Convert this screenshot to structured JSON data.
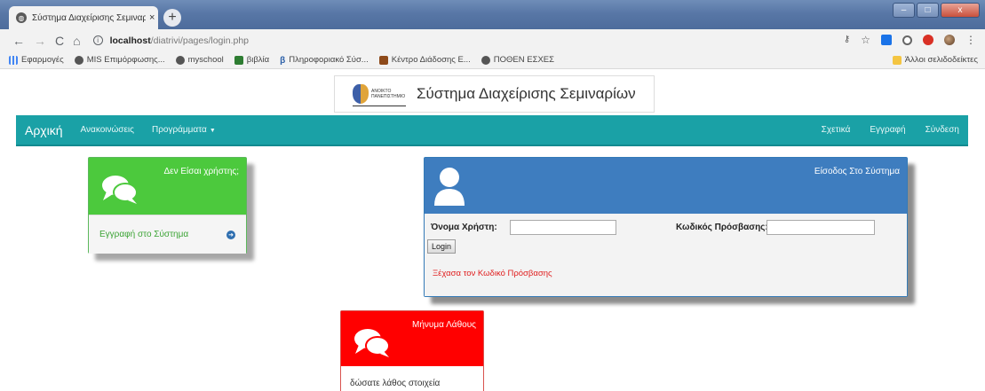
{
  "browser": {
    "tab_title": "Σύστημα Διαχείρισης Σεμιναρίω",
    "tab_close": "×",
    "new_tab": "+",
    "window_buttons": {
      "min": "–",
      "max": "□",
      "close": "x"
    },
    "url_host": "localhost",
    "url_path": "/diatrivi/pages/login.php",
    "bookmarks": [
      {
        "label": "Εφαρμογές",
        "icon": "apps-grid-icon"
      },
      {
        "label": "MIS Επιμόρφωσης...",
        "icon": "globe-icon"
      },
      {
        "label": "myschool",
        "icon": "globe-icon"
      },
      {
        "label": "βιβλία",
        "icon": "books-icon"
      },
      {
        "label": "Πληροφοριακό Σύσ...",
        "icon": "beta-icon"
      },
      {
        "label": "Κέντρο Διάδοσης Ε...",
        "icon": "kek-icon"
      },
      {
        "label": "ΠΟΘΕΝ ΕΣΧΕΣ",
        "icon": "globe-icon"
      }
    ],
    "other_bookmarks": "Άλλοι σελιδοδείκτες"
  },
  "header": {
    "logo_text": "ΑΝΟΙΚΤΟ ΠΑΝΕΠΙΣΤΗΜΙΟ",
    "site_title": "Σύστημα Διαχείρισης Σεμιναρίων"
  },
  "navbar": {
    "brand": "Αρχική",
    "links": [
      "Ανακοινώσεις",
      "Προγράμματα"
    ],
    "caret": "▼",
    "right": [
      "Σχετικά",
      "Εγγραφή",
      "Σύνδεση"
    ],
    "color": "#1aa1a6"
  },
  "register_panel": {
    "title": "Δεν Είσαι χρήστης;",
    "link": "Εγγραφή στο Σύστημα",
    "color": "#4cc93d"
  },
  "login_panel": {
    "title": "Είσοδος Στο Σύστημα",
    "username_label": "Όνομα Χρήστη:",
    "username_value": "",
    "password_label": "Κωδικός Πρόσβασης:",
    "password_value": "",
    "login_button": "Login",
    "forgot_link": "Ξέχασα τον Κωδικό Πρόσβασης",
    "color": "#3e7dbf"
  },
  "error_panel": {
    "title": "Μήνυμα Λάθους",
    "message": "δώσατε λάθος στοιχεία",
    "color": "#ff0000"
  }
}
